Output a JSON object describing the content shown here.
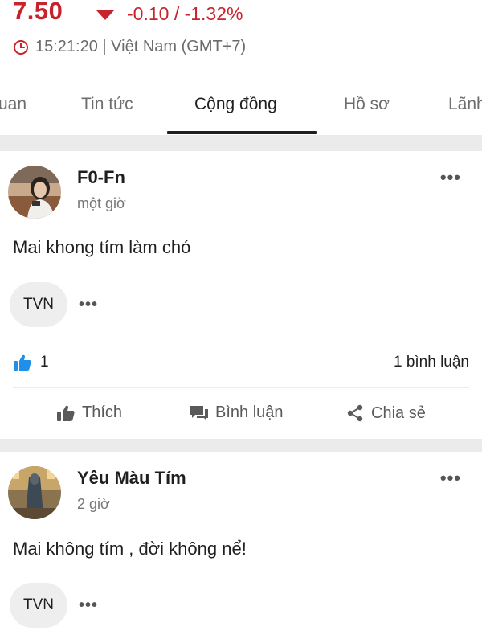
{
  "quote": {
    "price": "7.50",
    "change": "-0.10 / -1.32%",
    "time": "15:21:20 | Việt Nam (GMT+7)",
    "color_down": "#c8222c"
  },
  "tabs": [
    {
      "label": "uan"
    },
    {
      "label": "Tin tức"
    },
    {
      "label": "Cộng đồng",
      "active": true
    },
    {
      "label": "Hồ sơ"
    },
    {
      "label": "Lãnh"
    }
  ],
  "posts": [
    {
      "author": "F0-Fn",
      "time": "một giờ",
      "content": "Mai khong tím làm chó",
      "tag": "TVN",
      "likes": "1",
      "comments": "1 bình luận"
    },
    {
      "author": "Yêu Màu Tím",
      "time": "2 giờ",
      "content": "Mai không tím , đời không nể!",
      "tag": "TVN"
    }
  ],
  "actions": {
    "like": "Thích",
    "comment": "Bình luận",
    "share": "Chia sẻ"
  },
  "more_glyph": "•••",
  "icons": [
    "down-arrow-icon",
    "clock-icon",
    "more-icon",
    "thumbs-up-icon",
    "comment-icon",
    "share-icon"
  ]
}
